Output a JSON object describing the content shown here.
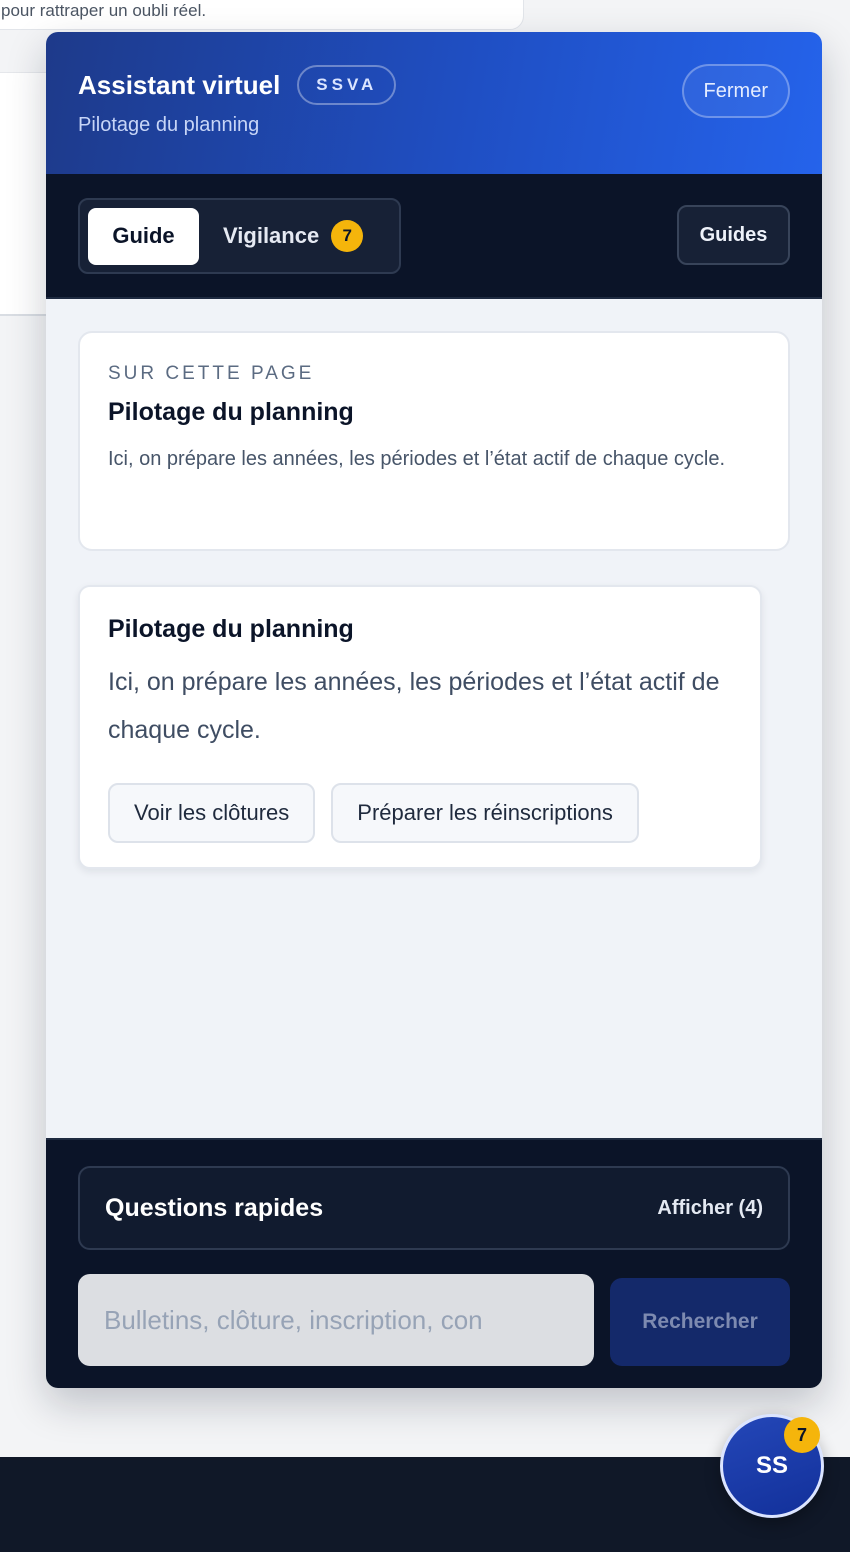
{
  "background": {
    "snippet_text": "pour rattraper un oubli réel."
  },
  "header": {
    "title": "Assistant virtuel",
    "badge": "SSVA",
    "subtitle": "Pilotage du planning",
    "close_label": "Fermer"
  },
  "tabs": {
    "guide_label": "Guide",
    "vigilance_label": "Vigilance",
    "vigilance_count": "7",
    "active": "Guide"
  },
  "guides_button_label": "Guides",
  "page_card": {
    "eyebrow": "SUR CETTE PAGE",
    "title": "Pilotage du planning",
    "description": "Ici, on prépare les années, les périodes et l’état actif de chaque cycle."
  },
  "info_card": {
    "title": "Pilotage du planning",
    "description": "Ici, on prépare les années, les périodes et l’état actif de chaque cycle.",
    "actions": [
      "Voir les clôtures",
      "Préparer les réinscriptions"
    ]
  },
  "quick_questions": {
    "title": "Questions rapides",
    "toggle_label": "Afficher (4)"
  },
  "search": {
    "placeholder": "Bulletins, clôture, inscription, con",
    "button_label": "Rechercher"
  },
  "fab": {
    "initials": "SS",
    "badge_count": "7"
  },
  "colors": {
    "header_gradient_start": "#1e3a8a",
    "header_gradient_end": "#2563eb",
    "dark_navy": "#0b1428",
    "badge_yellow": "#f5b50b"
  }
}
